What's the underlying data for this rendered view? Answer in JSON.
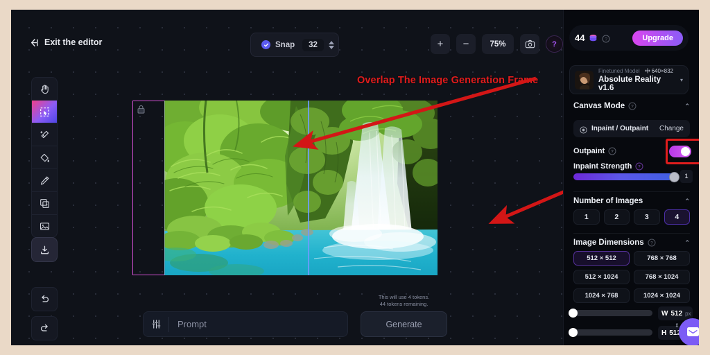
{
  "topbar": {
    "exit_label": "Exit the editor",
    "snap_label": "Snap",
    "snap_value": "32",
    "zoom_in": "+",
    "zoom_out": "−",
    "zoom_level": "75%",
    "camera_icon": "camera-icon",
    "help_icon": "help-icon",
    "help_glyph": "?"
  },
  "tools": [
    {
      "name": "hand-tool",
      "icon": "hand-icon",
      "active": false
    },
    {
      "name": "select-tool",
      "icon": "marquee-select-icon",
      "active": true
    },
    {
      "name": "magic-eraser-tool",
      "icon": "magic-eraser-icon",
      "active": false
    },
    {
      "name": "paint-bucket-tool",
      "icon": "paint-bucket-icon",
      "active": false
    },
    {
      "name": "brush-tool",
      "icon": "brush-icon",
      "active": false
    },
    {
      "name": "layers-tool",
      "icon": "layers-text-icon",
      "active": false
    },
    {
      "name": "image-tool",
      "icon": "image-icon",
      "active": false
    }
  ],
  "export_tool": {
    "name": "download-tool",
    "icon": "download-icon"
  },
  "history": [
    {
      "name": "undo-button",
      "icon": "undo-icon"
    },
    {
      "name": "redo-button",
      "icon": "redo-icon"
    }
  ],
  "canvas": {
    "lock_icon": "lock-icon",
    "annotation": "Overlap The Image Generation Frame",
    "annotation_color": "#e11c1c",
    "frame_color": "#d14fd1",
    "guide_color": "#6f9bff",
    "artwork_alt": "tropical rainforest waterfall with turquoise pool"
  },
  "prompt": {
    "settings_icon": "sliders-icon",
    "placeholder": "Prompt",
    "value": "",
    "generate_label": "Generate",
    "token_note_line1": "This will use 4 tokens.",
    "token_note_line2": "44 tokens remaining."
  },
  "panel": {
    "credits": {
      "amount": "44",
      "coin_icon": "token-coin-icon",
      "help_icon": "help-circle-icon",
      "upgrade_label": "Upgrade"
    },
    "model": {
      "kind": "Finetuned Model",
      "dimensions": "640×832",
      "resize_icon": "resize-icon",
      "name": "Absolute Reality v1.6",
      "caret": "▾"
    },
    "canvas_mode": {
      "title": "Canvas Mode",
      "collapse_caret": "⌃",
      "mode_icon": "inpaint-icon",
      "mode_label": "Inpaint / Outpaint",
      "change_label": "Change"
    },
    "outpaint": {
      "label": "Outpaint",
      "enabled": true,
      "accent": "#c244ea"
    },
    "inpaint_strength": {
      "label": "Inpaint Strength",
      "value": "1",
      "fill_percent": 100
    },
    "number_of_images": {
      "title": "Number of Images",
      "collapse_caret": "⌃",
      "options": [
        "1",
        "2",
        "3",
        "4"
      ],
      "selected": "4"
    },
    "image_dimensions": {
      "title": "Image Dimensions",
      "collapse_caret": "⌃",
      "options": [
        "512 × 512",
        "768 × 768",
        "512 × 1024",
        "768 × 1024",
        "1024 × 768",
        "1024 × 1024"
      ],
      "selected": "512 × 512"
    },
    "width": {
      "key": "W",
      "value": "512",
      "unit": "px",
      "slider_percent": 0
    },
    "height": {
      "key": "H",
      "value": "512",
      "unit": "px",
      "slider_percent": 0
    },
    "link_glyph": "⇕"
  },
  "chat_widget": {
    "name": "chat-launcher",
    "icon": "chat-icon"
  }
}
